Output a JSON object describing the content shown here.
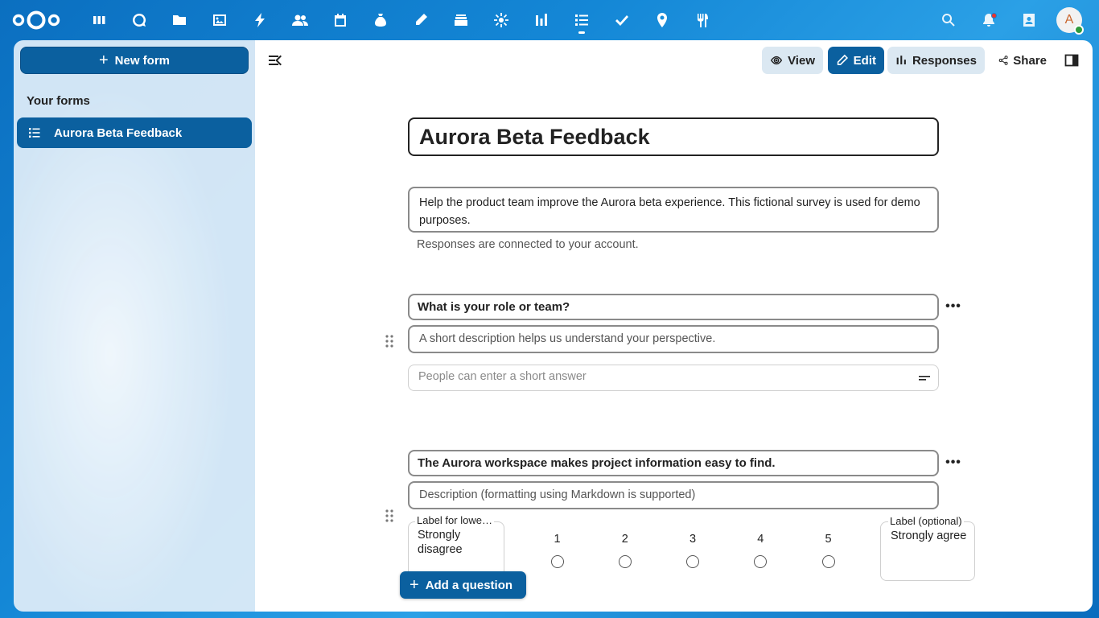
{
  "header": {
    "apps": [
      "dashboard",
      "search-app",
      "files",
      "photos",
      "activity",
      "contacts",
      "calendar",
      "budget",
      "notes",
      "deck",
      "tasks-hub",
      "analytics",
      "forms",
      "checklist",
      "maps",
      "cookbook"
    ],
    "avatar_initial": "A"
  },
  "sidebar": {
    "new_form_label": "New form",
    "section_title": "Your forms",
    "forms": [
      {
        "label": "Aurora Beta Feedback"
      }
    ]
  },
  "toolbar": {
    "view_label": "View",
    "edit_label": "Edit",
    "responses_label": "Responses",
    "share_label": "Share"
  },
  "form": {
    "title": "Aurora Beta Feedback",
    "description": "Help the product team improve the Aurora beta experience. This fictional survey is used for demo purposes.",
    "info": "Responses are connected to your account."
  },
  "questions": [
    {
      "title": "What is your role or team?",
      "description": "A short description helps us understand your perspective.",
      "answer_placeholder": "People can enter a short answer"
    },
    {
      "title": "The Aurora workspace makes project information easy to find.",
      "description_placeholder": "Description (formatting using Markdown is supported)",
      "lower_label_caption": "Label for lowe…",
      "lower_label_value": "Strongly disagree",
      "upper_label_caption": "Label (optional)",
      "upper_label_value": "Strongly agree",
      "scale": [
        "1",
        "2",
        "3",
        "4",
        "5"
      ]
    }
  ],
  "add_question_label": "Add a question",
  "colors": {
    "primary": "#0b609f",
    "header": "#1a7fce"
  }
}
